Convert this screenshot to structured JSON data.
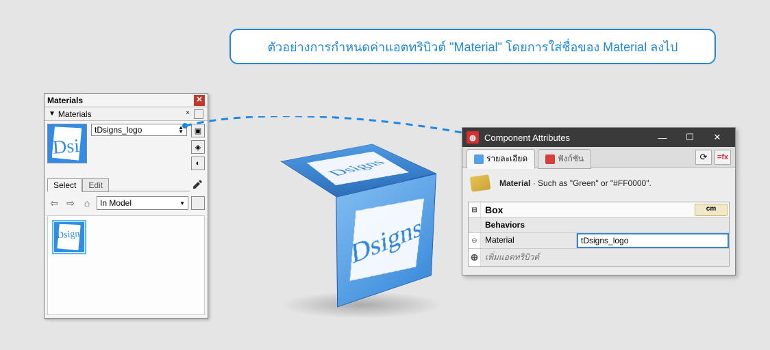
{
  "caption": "ตัวอย่างการกำหนดค่าแอตทริบิวต์ \"Material\" โดยการใส่ชื่อของ Material ลงไป",
  "materials_panel": {
    "title": "Materials",
    "subtitle": "Materials",
    "material_name": "tDsigns_logo",
    "tabs": {
      "select": "Select",
      "edit": "Edit"
    },
    "dropdown_selected": "In Model"
  },
  "component_attr": {
    "title": "Component Attributes",
    "tabs": {
      "info": "รายละเอียด",
      "functions": "ฟังก์ชัน"
    },
    "hint_label": "Material",
    "hint_text": " · Such as \"Green\" or \"#FF0000\".",
    "header_name": "Box",
    "unit_label": "cm",
    "section_behaviors": "Behaviors",
    "attr_material_label": "Material",
    "attr_material_value": "tDsigns_logo",
    "add_attr": "เพิ่มแอตทริบิวต์"
  }
}
